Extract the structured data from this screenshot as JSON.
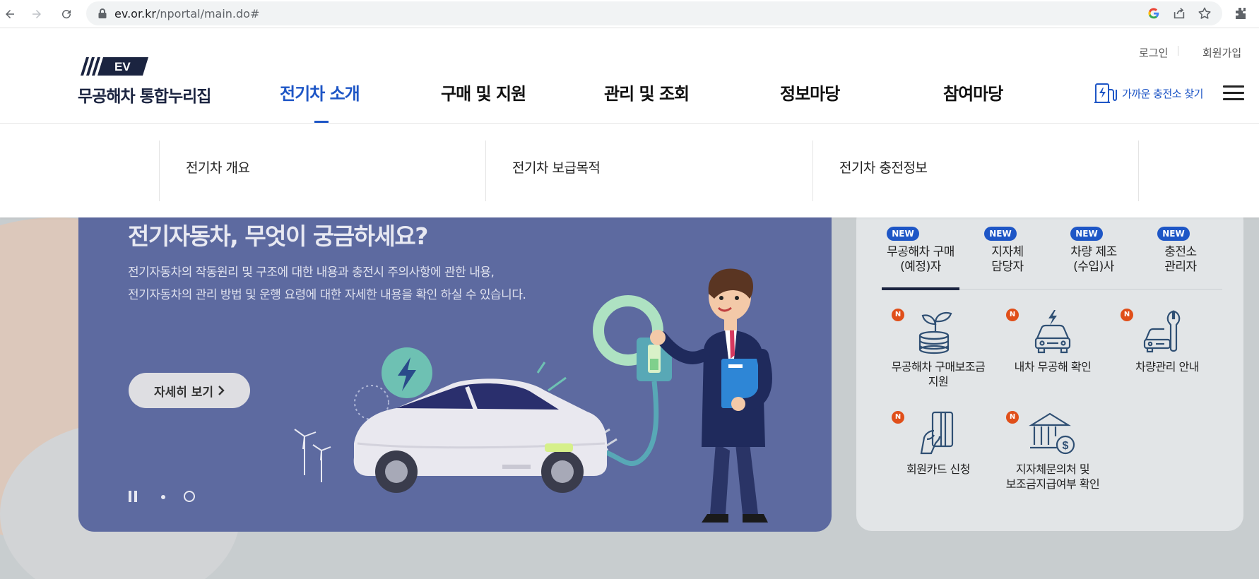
{
  "browser": {
    "url_host": "ev.or.kr",
    "url_path": "/nportal/main.do#"
  },
  "header": {
    "logo_text": "EV",
    "site_name": "무공해차 통합누리집",
    "login": "로그인",
    "signup": "회원가입",
    "nav": [
      "전기차 소개",
      "구매 및 지원",
      "관리 및 조회",
      "정보마당",
      "참여마당"
    ],
    "active_nav": "전기차 소개",
    "charge_find": "가까운 충전소 찾기"
  },
  "submenu": [
    "전기차 개요",
    "전기차 보급목적",
    "전기차 충전정보"
  ],
  "hero": {
    "title": "전기자동차, 무엇이 궁금하세요?",
    "desc_line1": "전기자동차의 작동원리 및 구조에 대한 내용과 충전시 주의사항에 관한 내용,",
    "desc_line2": "전기자동차의 관리 방법 및 운행 요령에 대한 자세한 내용을 확인 하실 수 있습니다.",
    "more_button": "자세히 보기",
    "bg_color": "#5d6aa0"
  },
  "quick": {
    "new_label": "NEW",
    "tabs": [
      {
        "label": "무공해차 구매\n(예정)자"
      },
      {
        "label": "지자체\n담당자"
      },
      {
        "label": "차량 제조\n(수입)사"
      },
      {
        "label": "충전소\n관리자"
      }
    ],
    "n_label": "N",
    "items": [
      {
        "label": "무공해차 구매보조금\n지원",
        "icon": "coin-plant-icon"
      },
      {
        "label": "내차 무공해 확인",
        "icon": "car-lightning-icon"
      },
      {
        "label": "차량관리 안내",
        "icon": "car-wrench-icon"
      },
      {
        "label": "회원카드 신청",
        "icon": "hand-card-icon"
      },
      {
        "label": "지자체문의처 및\n보조금지급여부 확인",
        "icon": "bank-dollar-icon"
      }
    ]
  },
  "colors": {
    "accent": "#1e56c6",
    "navy": "#1b2440",
    "badge_orange": "#e04f1a"
  }
}
